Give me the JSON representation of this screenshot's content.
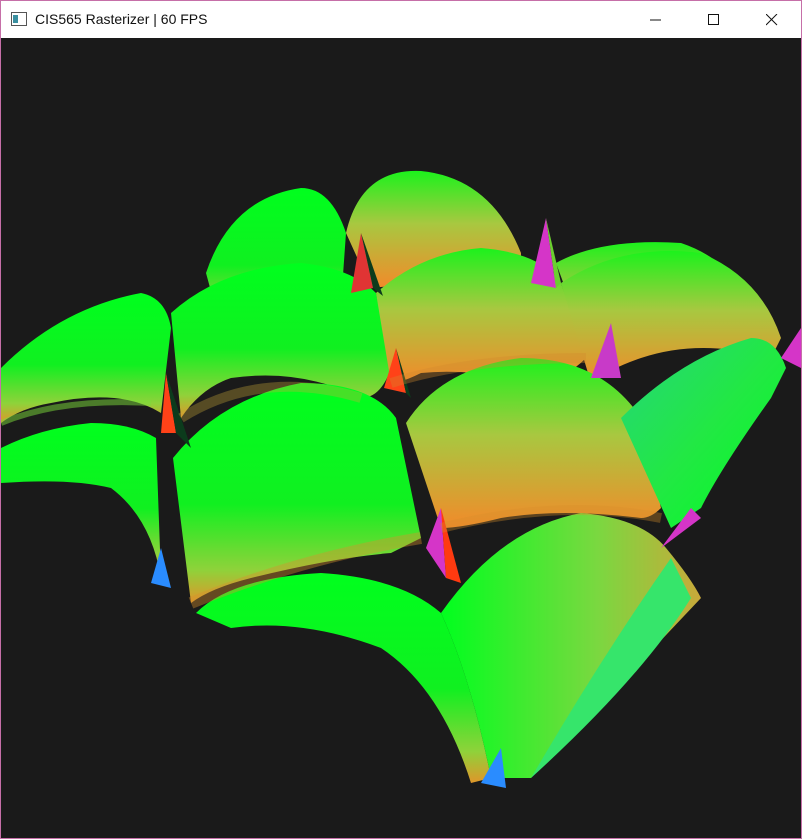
{
  "window": {
    "title": "CIS565 Rasterizer | 60 FPS"
  },
  "icons": {
    "app": "app-window-icon",
    "minimize": "minimize-icon",
    "maximize": "maximize-icon",
    "close": "close-icon"
  },
  "colors": {
    "background": "#1a1a1a",
    "window_border": "#c66fa8",
    "mesh_green": "#00ff19",
    "mesh_orange": "#ff8a24",
    "mesh_red": "#ff3a10",
    "mesh_magenta": "#d535c8",
    "mesh_blue": "#2a8cff"
  },
  "scene": {
    "description_type": "rendered-3d-mesh"
  }
}
